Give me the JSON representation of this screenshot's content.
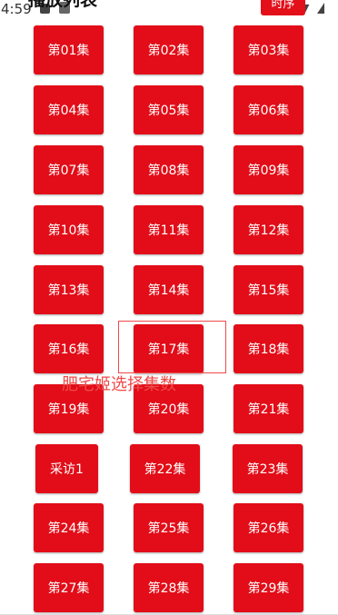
{
  "status_bar": {
    "time": "4:59"
  },
  "header": {
    "title": "播放列表",
    "right_button": "时序"
  },
  "hint": "肥宅姬选择集数",
  "episodes": [
    "第01集",
    "第02集",
    "第03集",
    "第04集",
    "第05集",
    "第06集",
    "第07集",
    "第08集",
    "第09集",
    "第10集",
    "第11集",
    "第12集",
    "第13集",
    "第14集",
    "第15集",
    "第16集",
    "第17集",
    "第18集",
    "第19集",
    "第20集",
    "第21集",
    "采访1",
    "第22集",
    "第23集",
    "第24集",
    "第25集",
    "第26集",
    "第27集",
    "第28集",
    "第29集"
  ],
  "focused_episode": "第17集",
  "colors": {
    "button": "#e20d18",
    "hint": "#ee4a4a"
  }
}
